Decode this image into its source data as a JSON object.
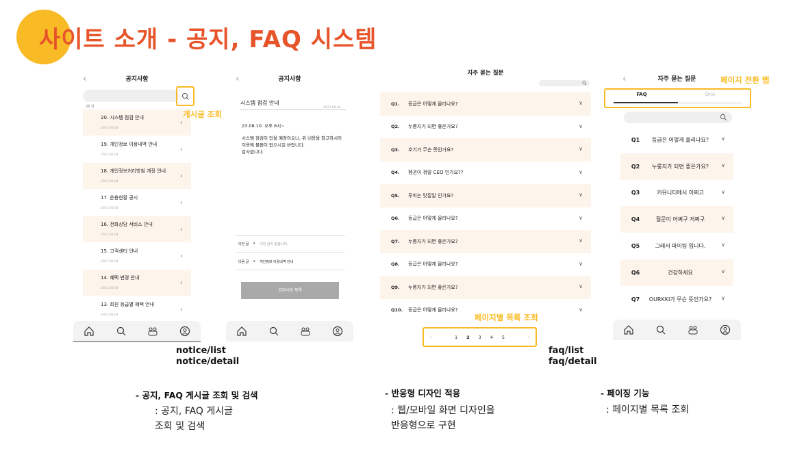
{
  "title": "사이트 소개 - 공지, FAQ 시스템",
  "colors": {
    "accent": "#f9bb25",
    "title": "#e7542a",
    "row_alt": "#fdf4ec"
  },
  "notice_list": {
    "header": "공지사항",
    "count": "26 건",
    "items": [
      {
        "label": "20.  시스템 점검 안내",
        "date": "2023.06.04"
      },
      {
        "label": "19.  개인정보 이용내역 안내",
        "date": "2023.06.04"
      },
      {
        "label": "18.  개인정보처리방침 개정 안내",
        "date": "2023.06.04"
      },
      {
        "label": "17.  운용현황 공시",
        "date": "2023.06.04"
      },
      {
        "label": "16.  전화상담 서비스 안내",
        "date": "2023.06.04"
      },
      {
        "label": "15.  고객센터 안내",
        "date": "2023.06.04"
      },
      {
        "label": "14.  혜택 변경 안내",
        "date": "2023.06.04"
      },
      {
        "label": "13.  회원 등급별 혜택 안내",
        "date": "2023.06.04"
      }
    ]
  },
  "notice_detail": {
    "header": "공지사항",
    "subject": "시스템 점검 안내",
    "date": "2023.06.04",
    "time": "23.08.10. 오후 6시~",
    "body": "시스템 점검이 있을 예정이오니, 위 내용을 참고하시어 이용에 불편이 없으시길 바랍니다.\n감사합니다.",
    "prev_label": "이전 글",
    "prev_text": "이전 글이 없습니다.",
    "next_label": "다음 글",
    "next_text": "개인정보 이용내역 안내",
    "list_button": "공지사항 목록"
  },
  "faq_list": {
    "header": "자주 묻는 질문",
    "items": [
      {
        "q": "Q1.",
        "t": "등급은 어떻게 올리나요?"
      },
      {
        "q": "Q2.",
        "t": "누룽지가 되면 좋은가요?"
      },
      {
        "q": "Q3.",
        "t": "호기가 무슨 뜻인가요?"
      },
      {
        "q": "Q4.",
        "t": "펭귄이 정말 CEO 인가요??"
      },
      {
        "q": "Q5.",
        "t": "루피는 맛잘알 인가요?"
      },
      {
        "q": "Q6.",
        "t": "등급은 어떻게 올리나요?"
      },
      {
        "q": "Q7.",
        "t": "누룽지가 되면 좋은가요?"
      },
      {
        "q": "Q8.",
        "t": "등급은 어떻게 올리나요?"
      },
      {
        "q": "Q9.",
        "t": "누룽지가 되면 좋은가요?"
      },
      {
        "q": "Q10.",
        "t": "등급은 어떻게 올리나요?"
      }
    ],
    "pages": [
      "1",
      "2",
      "3",
      "4",
      "5"
    ],
    "current_page": "2"
  },
  "faq_mobile": {
    "header": "자주 묻는 질문",
    "tabs": [
      "FAQ",
      "QnA"
    ],
    "items": [
      {
        "q": "Q1",
        "t": "등급은 어떻게 올리나요?"
      },
      {
        "q": "Q2",
        "t": "누룽지가 되면 좋은가요?"
      },
      {
        "q": "Q3",
        "t": "커뮤니티에서 어쩌고"
      },
      {
        "q": "Q4",
        "t": "질문이 어쩌구 저쩌구"
      },
      {
        "q": "Q5",
        "t": "그래서 파이팅 입니다."
      },
      {
        "q": "Q6",
        "t": "건강하세요"
      },
      {
        "q": "Q7",
        "t": "OURKKI가 무슨 뜻인가요?"
      }
    ]
  },
  "annotations": {
    "search": "게시글 조회",
    "tabs": "페이지 전환 탭",
    "paging": "페이지별 목록 조회"
  },
  "routes": {
    "notice": [
      "notice/list",
      "notice/detail"
    ],
    "faq": [
      "faq/list",
      "faq/detail"
    ]
  },
  "sections": [
    {
      "head": "- 공지, FAQ 게시글 조회 및 검색",
      "body": [
        ": 공지, FAQ 게시글",
        "조회 및 검색"
      ]
    },
    {
      "head": "- 반응형 디자인 적용",
      "body": [
        ": 웹/모바일 화면 디자인을",
        "반응형으로 구현"
      ]
    },
    {
      "head": "- 페이징 기능",
      "body": [
        ": 페이지별 목록 조회"
      ]
    }
  ]
}
